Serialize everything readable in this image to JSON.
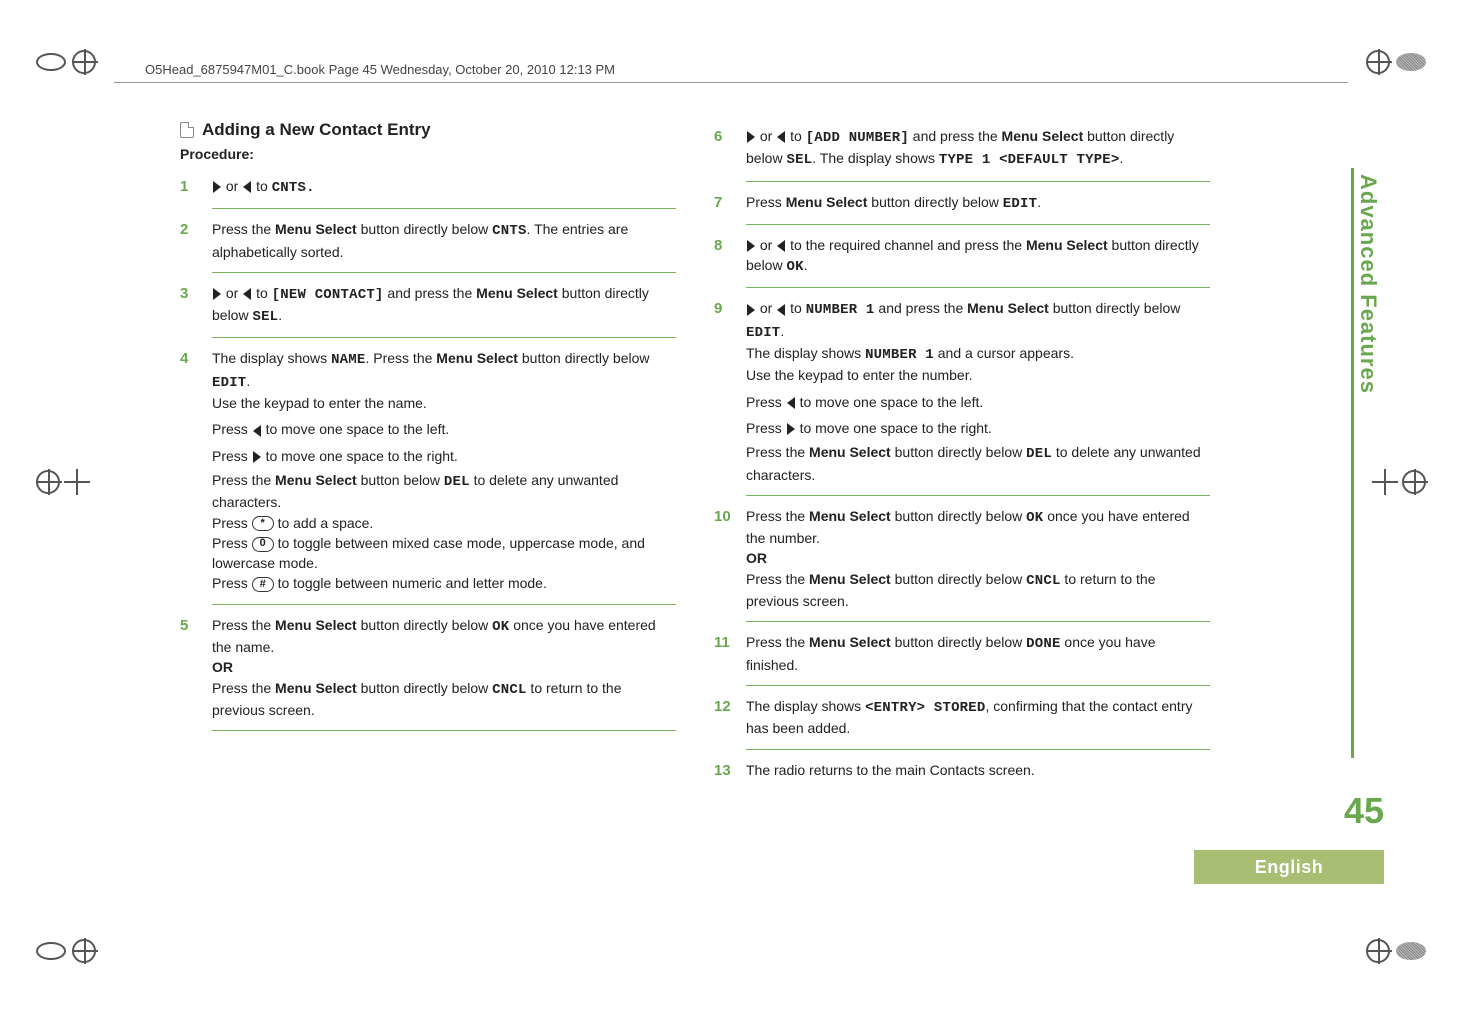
{
  "running_head": "O5Head_6875947M01_C.book  Page 45  Wednesday, October 20, 2010  12:13 PM",
  "side_tab": "Advanced Features",
  "page_number": "45",
  "footer_lang": "English",
  "left": {
    "heading": "Adding a New Contact Entry",
    "procedure_label": "Procedure:",
    "step1": {
      "pre": "",
      "end": " to ",
      "target": "CNTS.",
      "suffix": ""
    },
    "step2": {
      "a": "Press the ",
      "b": "Menu Select",
      "c": " button directly below ",
      "d": "CNTS",
      "e": ". The entries are alphabetically sorted."
    },
    "step3": {
      "a": " or ",
      "b": " to ",
      "c": "[NEW CONTACT]",
      "d": " and press the ",
      "e": "Menu Select",
      "f": " button directly below ",
      "g": "SEL",
      "h": "."
    },
    "step4": {
      "l1a": "The display shows ",
      "l1b": "NAME",
      "l1c": ". Press the ",
      "l1d": "Menu Select",
      "l1e": " button directly below ",
      "l1f": "EDIT",
      "l1g": ".",
      "l2": "Use the keypad to enter the name.",
      "l3a": "Press ",
      "l3b": " to move one space to the left.",
      "l4a": "Press ",
      "l4b": " to move one space to the right.",
      "l5a": "Press the ",
      "l5b": "Menu Select",
      "l5c": " button below ",
      "l5d": "DEL",
      "l5e": " to delete any unwanted characters.",
      "l6a": "Press ",
      "l6b": "*",
      "l6c": " to add a space.",
      "l7a": "Press ",
      "l7b": "0",
      "l7c": " to toggle between mixed case mode, uppercase mode, and lowercase mode.",
      "l8a": "Press ",
      "l8b": "#",
      "l8c": " to toggle between numeric and letter mode."
    },
    "step5": {
      "l1a": "Press the ",
      "l1b": "Menu Select",
      "l1c": " button directly below ",
      "l1d": "OK",
      "l1e": " once you have entered the name.",
      "or": "OR",
      "l2a": "Press the ",
      "l2b": "Menu Select",
      "l2c": " button directly below ",
      "l2d": "CNCL",
      "l2e": " to return to the previous screen."
    }
  },
  "right": {
    "step6": {
      "a": " or ",
      "b": " to ",
      "c": "[ADD NUMBER]",
      "d": " and press the ",
      "e": "Menu Select",
      "f": " button directly below ",
      "g": "SEL",
      "h": ". The display shows ",
      "i": "TYPE 1 <DEFAULT TYPE>",
      "j": "."
    },
    "step7": {
      "a": "Press ",
      "b": "Menu Select",
      "c": " button directly below ",
      "d": "EDIT",
      "e": "."
    },
    "step8": {
      "a": " or ",
      "b": " to the required channel and press the ",
      "c": "Menu Select",
      "d": " button directly below ",
      "e": "OK",
      "f": "."
    },
    "step9": {
      "l1a": " or ",
      "l1b": " to ",
      "l1c": "NUMBER 1",
      "l1d": " and press the ",
      "l1e": "Menu Select",
      "l1f": " button directly below ",
      "l1g": "EDIT",
      "l1h": ".",
      "l2a": "The display shows ",
      "l2b": "NUMBER 1",
      "l2c": " and a cursor appears.",
      "l3": "Use the keypad to enter the number.",
      "l4a": "Press ",
      "l4b": " to move one space to the left.",
      "l5a": "Press ",
      "l5b": " to move one space to the right.",
      "l6a": "Press the ",
      "l6b": "Menu Select",
      "l6c": " button directly below ",
      "l6d": "DEL",
      "l6e": " to delete any unwanted characters."
    },
    "step10": {
      "l1a": "Press the ",
      "l1b": "Menu Select",
      "l1c": " button directly below ",
      "l1d": "OK",
      "l1e": " once you have entered the number.",
      "or": "OR",
      "l2a": "Press the ",
      "l2b": "Menu Select",
      "l2c": " button directly below ",
      "l2d": "CNCL",
      "l2e": " to return to the previous screen."
    },
    "step11": {
      "a": "Press the ",
      "b": "Menu Select",
      "c": " button directly below ",
      "d": "DONE",
      "e": " once you have finished."
    },
    "step12": {
      "a": "The display shows ",
      "b": "<ENTRY> STORED",
      "c": ", confirming that the contact entry has been added."
    },
    "step13": {
      "a": "The radio returns to the main Contacts screen."
    },
    "numbers": {
      "n6": "6",
      "n7": "7",
      "n8": "8",
      "n9": "9",
      "n10": "10",
      "n11": "11",
      "n12": "12",
      "n13": "13"
    }
  },
  "nums": {
    "n1": "1",
    "n2": "2",
    "n3": "3",
    "n4": "4",
    "n5": "5"
  }
}
